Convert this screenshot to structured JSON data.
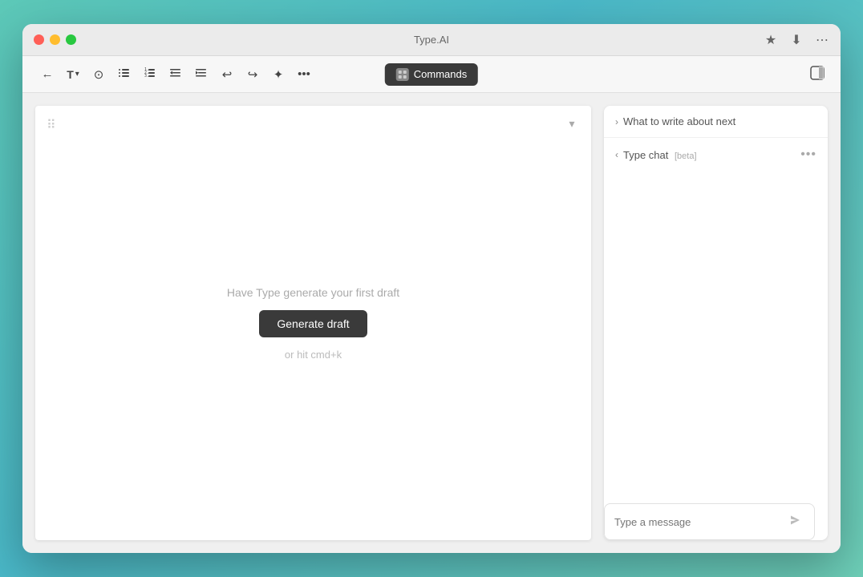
{
  "window": {
    "title": "Type.AI"
  },
  "titlebar": {
    "close_label": "",
    "min_label": "",
    "max_label": "",
    "extension_icon": "★",
    "download_icon": "⬇",
    "more_icon": "⋯"
  },
  "toolbar": {
    "back_icon": "←",
    "text_icon": "T",
    "dropdown_icon": "▾",
    "spell_icon": "⊙",
    "bullet_icon": "☰",
    "numbered_icon": "≡",
    "indent_dec_icon": "⇤",
    "indent_inc_icon": "⇥",
    "undo_icon": "↩",
    "redo_icon": "↪",
    "magic_icon": "✦",
    "more_icon": "•••",
    "commands_label": "Commands",
    "sidebar_toggle_icon": "▣"
  },
  "editor": {
    "drag_handle": "⠿",
    "hint_text": "Have Type generate your first draft",
    "generate_btn_label": "Generate draft",
    "shortcut_hint": "or hit cmd+k",
    "collapse_icon": "▾"
  },
  "sidebar": {
    "what_to_write": {
      "label": "What to write about next",
      "chevron": "›"
    },
    "type_chat": {
      "label": "Type chat",
      "beta": "[beta]",
      "more_icon": "•••",
      "chevron": "‹"
    },
    "chat_input": {
      "placeholder": "Type a message",
      "send_icon": "›"
    }
  }
}
